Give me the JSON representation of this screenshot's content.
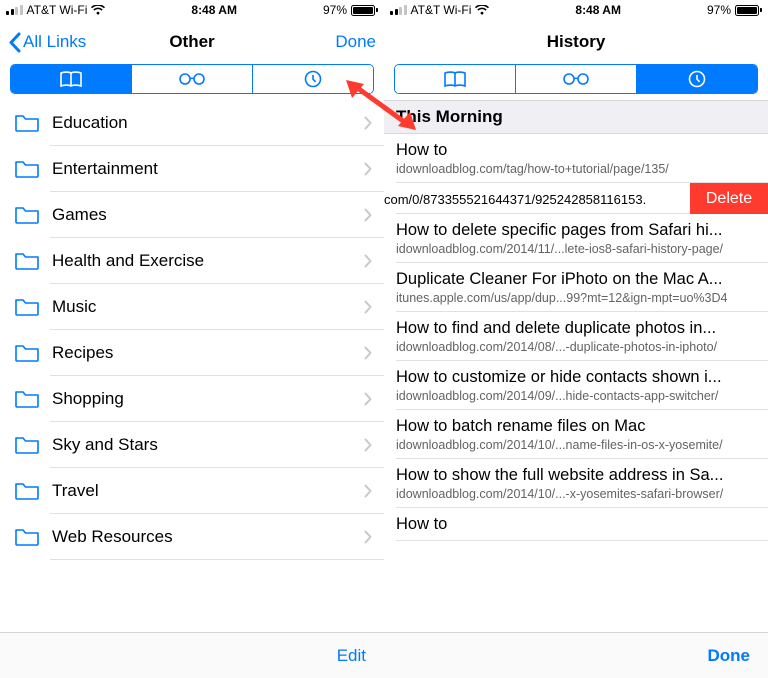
{
  "status": {
    "carrier": "AT&T Wi-Fi",
    "time": "8:48 AM",
    "battery_pct": "97%",
    "battery_fill_pct": 97
  },
  "left": {
    "back_label": "All Links",
    "title": "Other",
    "done_label": "Done",
    "segmented_active": 0,
    "segments": [
      "bookmarks",
      "reading-list",
      "history"
    ],
    "folders": [
      "Education",
      "Entertainment",
      "Games",
      "Health and Exercise",
      "Music",
      "Recipes",
      "Shopping",
      "Sky and Stars",
      "Travel",
      "Web Resources"
    ],
    "toolbar_label": "Edit"
  },
  "right": {
    "title": "History",
    "segmented_active": 2,
    "segments": [
      "bookmarks",
      "reading-list",
      "history"
    ],
    "section_header": "This Morning",
    "delete_label": "Delete",
    "toolbar_label": "Done",
    "items": [
      {
        "title": "How to",
        "url": "idownloadblog.com/tag/how-to+tutorial/page/135/"
      },
      {
        "title": "",
        "url": ".com/0/873355521644371/925242858116153",
        "swiped": true
      },
      {
        "title": "How to delete specific pages from Safari hi...",
        "url": "idownloadblog.com/2014/11/...lete-ios8-safari-history-page/"
      },
      {
        "title": "Duplicate Cleaner For iPhoto on the Mac A...",
        "url": "itunes.apple.com/us/app/dup...99?mt=12&ign-mpt=uo%3D4"
      },
      {
        "title": "How to find and delete duplicate photos in...",
        "url": "idownloadblog.com/2014/08/...-duplicate-photos-in-iphoto/"
      },
      {
        "title": "How to customize or hide contacts shown i...",
        "url": "idownloadblog.com/2014/09/...hide-contacts-app-switcher/"
      },
      {
        "title": "How to batch rename files on Mac",
        "url": "idownloadblog.com/2014/10/...name-files-in-os-x-yosemite/"
      },
      {
        "title": "How to show the full website address in Sa...",
        "url": "idownloadblog.com/2014/10/...-x-yosemites-safari-browser/"
      },
      {
        "title": "How to",
        "url": ""
      }
    ]
  },
  "annotation": {
    "arrow_color": "#ff3b30"
  }
}
